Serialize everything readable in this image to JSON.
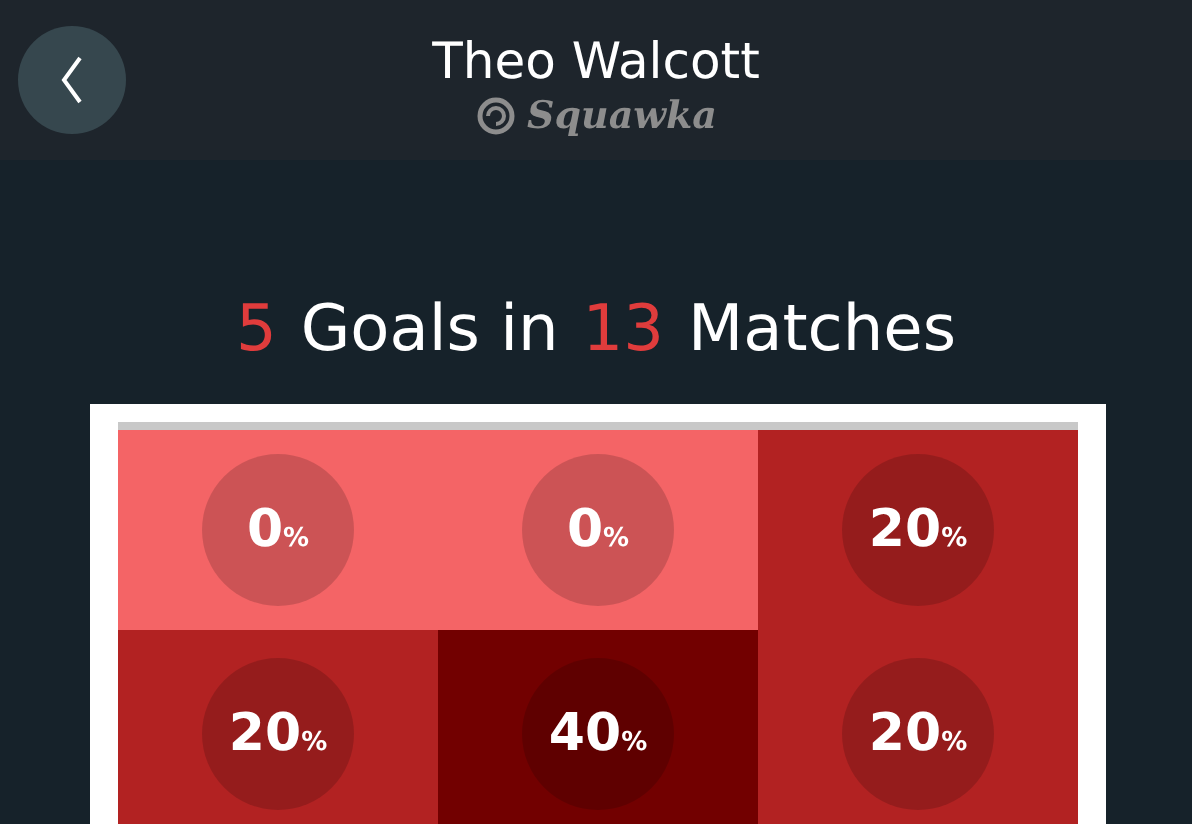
{
  "header": {
    "title": "Theo Walcott",
    "brand": "Squawka"
  },
  "summary": {
    "goals": "5",
    "goals_label": "Goals in",
    "matches": "13",
    "matches_label": "Matches"
  },
  "grid": [
    {
      "value": "0",
      "unit": "%",
      "color": "#f46466"
    },
    {
      "value": "0",
      "unit": "%",
      "color": "#f46466"
    },
    {
      "value": "20",
      "unit": "%",
      "color": "#b22222"
    },
    {
      "value": "20",
      "unit": "%",
      "color": "#b22222"
    },
    {
      "value": "40",
      "unit": "%",
      "color": "#720000"
    },
    {
      "value": "20",
      "unit": "%",
      "color": "#b22222"
    }
  ]
}
